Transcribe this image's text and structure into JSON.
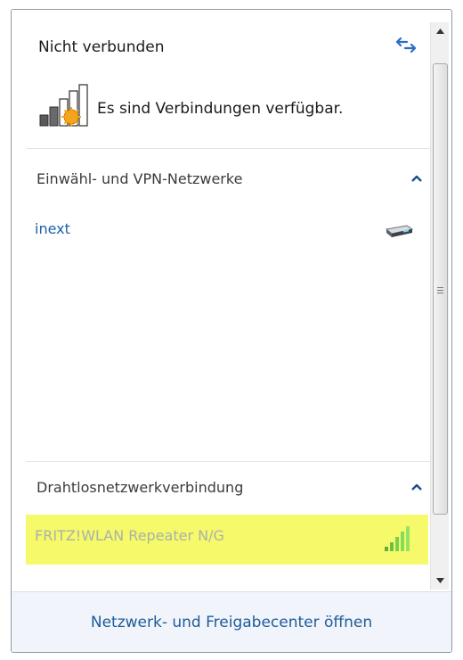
{
  "status": {
    "title": "Nicht verbunden",
    "connection_text": "Es sind Verbindungen verfügbar.",
    "refresh_icon": "refresh-icon",
    "connection_icon": "signal-star-icon"
  },
  "groups": [
    {
      "label": "Einwähl- und VPN-Netzwerke",
      "chevron": "chevron-up-icon",
      "items": [
        {
          "name": "inext",
          "icon": "modem-icon",
          "name_color": "#1e5fb0"
        }
      ]
    },
    {
      "label": "Drahtlosnetzwerkverbindung",
      "chevron": "chevron-up-icon",
      "items": [
        {
          "name": "FRITZ!WLAN Repeater N/G",
          "icon": "signal-strength-icon",
          "name_color": "#a9b3a8",
          "highlighted": true,
          "highlight_color": "#f6f96a"
        }
      ]
    }
  ],
  "footer": {
    "link": "Netzwerk- und Freigabecenter öffnen"
  },
  "colors": {
    "link": "#1e5b9a",
    "footer_bg": "#f1f5fb",
    "chevron": "#1c4f8c"
  }
}
